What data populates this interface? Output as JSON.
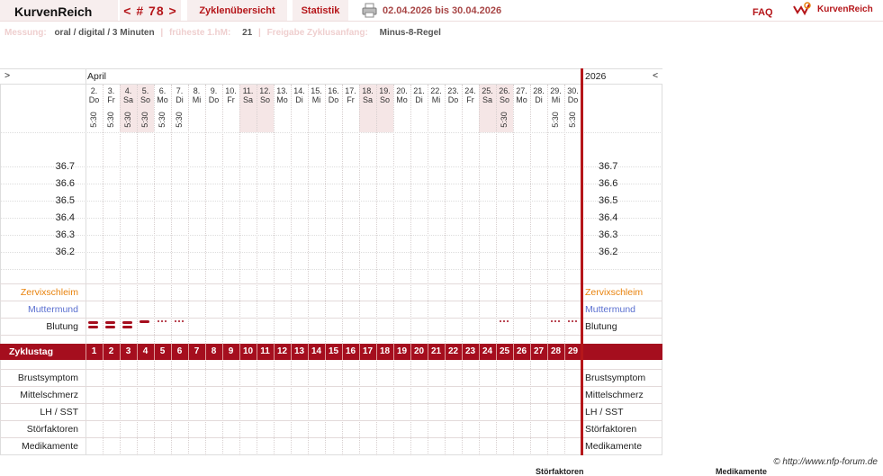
{
  "app_title": "KurvenReich",
  "nav": {
    "cycle_label": "< # 78 >",
    "overview_label": "Zyklenübersicht",
    "stats_label": "Statistik",
    "date_range": "02.04.2026 bis 30.04.2026",
    "faq_label": "FAQ",
    "logo_text": "KurvenReich"
  },
  "meta": {
    "measure_label": "Messung:",
    "measure_value": "oral / digital / 3 Minuten",
    "earliest_label": "früheste 1.hM:",
    "earliest_value": "21",
    "release_label": "Freigabe Zyklusanfang:",
    "release_value": "Minus-8-Regel"
  },
  "chart": {
    "prev_arrow": ">",
    "next_arrow": "<",
    "month": "April",
    "year": "2026",
    "temp_ticks": [
      "36.7",
      "36.6",
      "36.5",
      "36.4",
      "36.3",
      "36.2"
    ],
    "row_labels": {
      "zervix": "Zervixschleim",
      "muttermund": "Muttermund",
      "blutung": "Blutung",
      "zyklustag": "Zyklustag",
      "brust": "Brustsymptom",
      "mittel": "Mittelschmerz",
      "lh": "LH / SST",
      "stoer": "Störfaktoren",
      "medi": "Medikamente"
    },
    "days": [
      {
        "d": "2.",
        "w": "Do",
        "t": "5:30",
        "we": false,
        "bleed": "heavy"
      },
      {
        "d": "3.",
        "w": "Fr",
        "t": "5:30",
        "we": false,
        "bleed": "heavy"
      },
      {
        "d": "4.",
        "w": "Sa",
        "t": "5:30",
        "we": true,
        "bleed": "heavy"
      },
      {
        "d": "5.",
        "w": "So",
        "t": "5:30",
        "we": true,
        "bleed": "medium"
      },
      {
        "d": "6.",
        "w": "Mo",
        "t": "5:30",
        "we": false,
        "bleed": "spot"
      },
      {
        "d": "7.",
        "w": "Di",
        "t": "5:30",
        "we": false,
        "bleed": "spot"
      },
      {
        "d": "8.",
        "w": "Mi",
        "t": "",
        "we": false,
        "bleed": ""
      },
      {
        "d": "9.",
        "w": "Do",
        "t": "",
        "we": false,
        "bleed": ""
      },
      {
        "d": "10.",
        "w": "Fr",
        "t": "",
        "we": false,
        "bleed": ""
      },
      {
        "d": "11.",
        "w": "Sa",
        "t": "",
        "we": true,
        "bleed": ""
      },
      {
        "d": "12.",
        "w": "So",
        "t": "",
        "we": true,
        "bleed": ""
      },
      {
        "d": "13.",
        "w": "Mo",
        "t": "",
        "we": false,
        "bleed": ""
      },
      {
        "d": "14.",
        "w": "Di",
        "t": "",
        "we": false,
        "bleed": ""
      },
      {
        "d": "15.",
        "w": "Mi",
        "t": "",
        "we": false,
        "bleed": ""
      },
      {
        "d": "16.",
        "w": "Do",
        "t": "",
        "we": false,
        "bleed": ""
      },
      {
        "d": "17.",
        "w": "Fr",
        "t": "",
        "we": false,
        "bleed": ""
      },
      {
        "d": "18.",
        "w": "Sa",
        "t": "",
        "we": true,
        "bleed": ""
      },
      {
        "d": "19.",
        "w": "So",
        "t": "",
        "we": true,
        "bleed": ""
      },
      {
        "d": "20.",
        "w": "Mo",
        "t": "",
        "we": false,
        "bleed": ""
      },
      {
        "d": "21.",
        "w": "Di",
        "t": "",
        "we": false,
        "bleed": ""
      },
      {
        "d": "22.",
        "w": "Mi",
        "t": "",
        "we": false,
        "bleed": ""
      },
      {
        "d": "23.",
        "w": "Do",
        "t": "",
        "we": false,
        "bleed": ""
      },
      {
        "d": "24.",
        "w": "Fr",
        "t": "",
        "we": false,
        "bleed": ""
      },
      {
        "d": "25.",
        "w": "Sa",
        "t": "",
        "we": true,
        "bleed": ""
      },
      {
        "d": "26.",
        "w": "So",
        "t": "5:30",
        "we": true,
        "bleed": "spot"
      },
      {
        "d": "27.",
        "w": "Mo",
        "t": "",
        "we": false,
        "bleed": ""
      },
      {
        "d": "28.",
        "w": "Di",
        "t": "",
        "we": false,
        "bleed": ""
      },
      {
        "d": "29.",
        "w": "Mi",
        "t": "5:30",
        "we": false,
        "bleed": "spot"
      },
      {
        "d": "30.",
        "w": "Do",
        "t": "5:30",
        "we": false,
        "bleed": "spot"
      }
    ]
  },
  "footer": "© http://www.nfp-forum.de",
  "cut_off": [
    "Störfaktoren",
    "Medikamente"
  ],
  "colors": {
    "accent": "#b5161a",
    "zervix": "#e8820c",
    "muttermund": "#5a6fd0",
    "weekend": "#f5e6e6",
    "bar": "#a50e1e"
  }
}
